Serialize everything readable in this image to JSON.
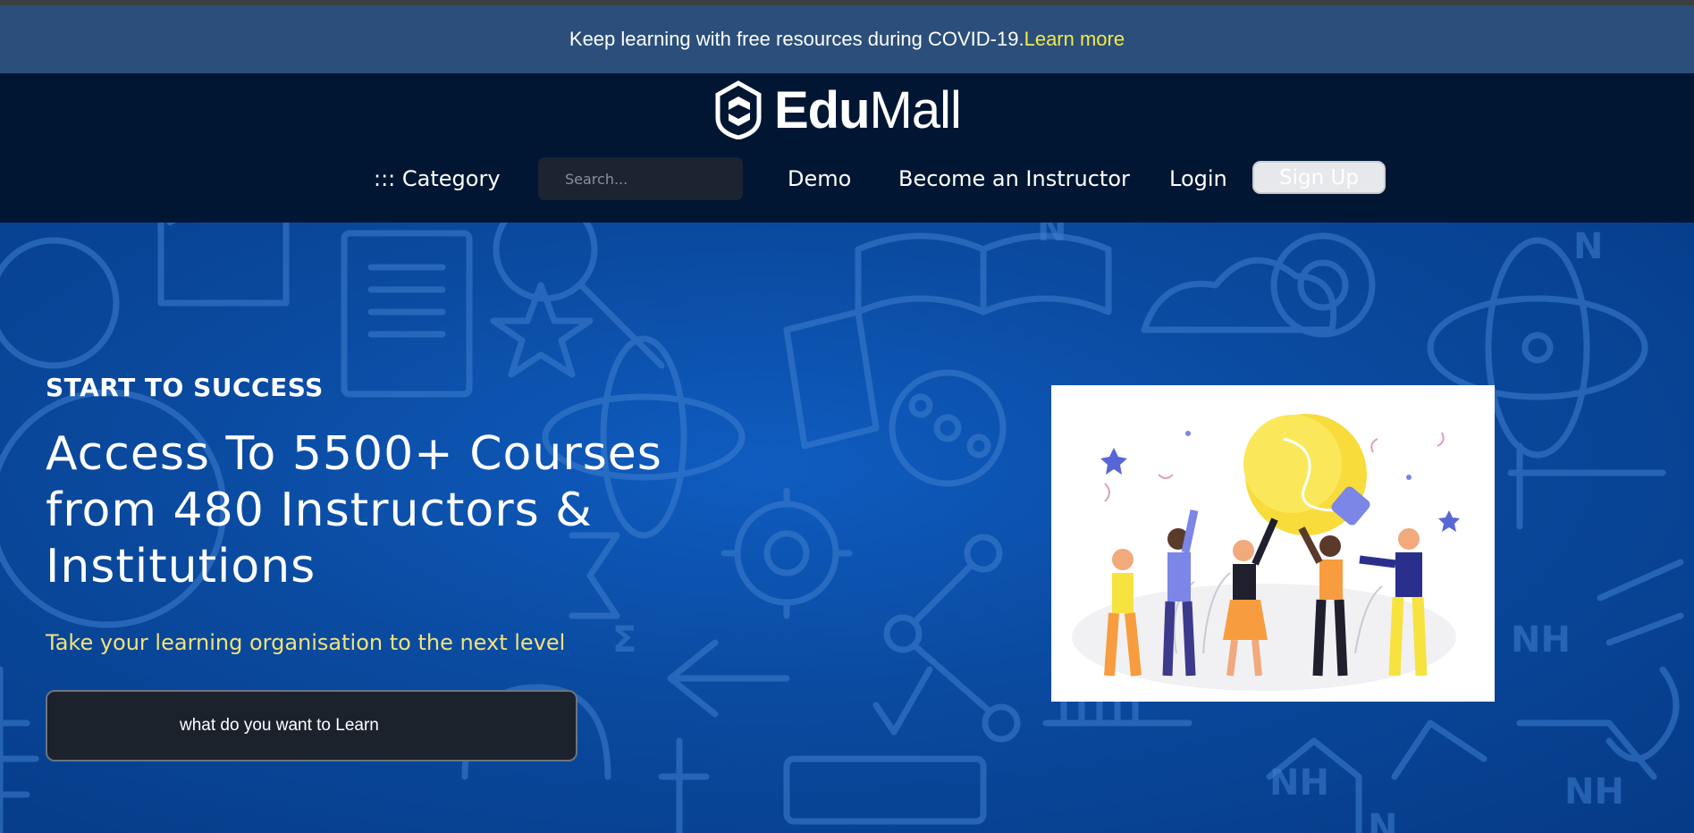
{
  "announcement": {
    "text": "Keep learning with free resources during COVID-19.",
    "link": "Learn more"
  },
  "brand": {
    "name_bold": "Edu",
    "name_regular": "Mall"
  },
  "nav": {
    "category": "::: Category",
    "search_placeholder": "Search...",
    "demo": "Demo",
    "instructor": "Become an Instructor",
    "login": "Login",
    "signup": "Sign Up"
  },
  "hero": {
    "eyebrow": "START TO SUCCESS",
    "headline": "Access To 5500+ Courses from 480 Instructors & Institutions",
    "tagline": "Take your learning organisation to the next level",
    "cta": "what do you want to Learn"
  },
  "colors": {
    "announcement_bg": "#2b4f7a",
    "header_bg": "#011633",
    "hero_blue": "#0a4aa0",
    "link_yellow": "#f2ea4a",
    "tagline_yellow": "#f3e27a"
  },
  "icons": [
    "edumall-shield-logo-icon",
    "education-doodle-pattern",
    "lightbulb-teamwork-illustration"
  ]
}
